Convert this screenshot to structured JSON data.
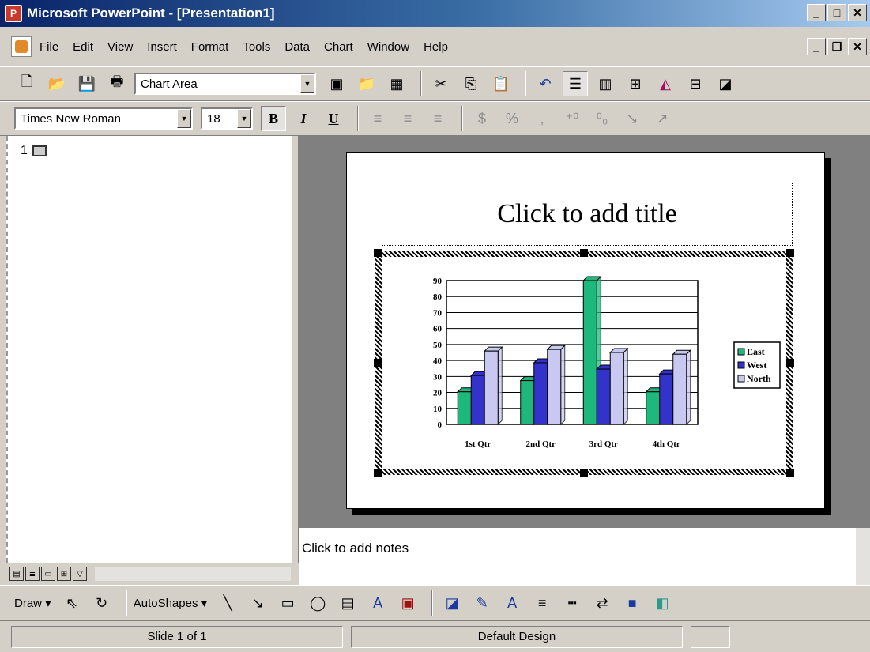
{
  "window": {
    "title": "Microsoft PowerPoint - [Presentation1]"
  },
  "menu": [
    "File",
    "Edit",
    "View",
    "Insert",
    "Format",
    "Tools",
    "Data",
    "Chart",
    "Window",
    "Help"
  ],
  "toolbar": {
    "chart_object": "Chart Area"
  },
  "formatting": {
    "font": "Times New Roman",
    "size": "18",
    "bold": "B",
    "italic": "I",
    "underline": "U"
  },
  "outline": {
    "slide_number": "1"
  },
  "slide": {
    "title_placeholder": "Click to add title"
  },
  "notes": {
    "placeholder": "Click to add notes"
  },
  "drawing": {
    "draw_label": "Draw",
    "autoshapes_label": "AutoShapes"
  },
  "status": {
    "slide": "Slide 1 of 1",
    "design": "Default Design"
  },
  "chart_data": {
    "type": "bar",
    "categories": [
      "1st Qtr",
      "2nd Qtr",
      "3rd Qtr",
      "4th Qtr"
    ],
    "series": [
      {
        "name": "East",
        "values": [
          20.4,
          27.4,
          90,
          20.4
        ],
        "color": "#1fb87c"
      },
      {
        "name": "West",
        "values": [
          30.6,
          38.6,
          34.6,
          31.6
        ],
        "color": "#3333cc"
      },
      {
        "name": "North",
        "values": [
          45.9,
          46.9,
          45,
          43.9
        ],
        "color": "#c8c8f0"
      }
    ],
    "ylim": [
      0,
      90
    ],
    "yticks": [
      0,
      10,
      20,
      30,
      40,
      50,
      60,
      70,
      80,
      90
    ],
    "legend": "right",
    "grid": true,
    "title": "",
    "xlabel": "",
    "ylabel": ""
  }
}
